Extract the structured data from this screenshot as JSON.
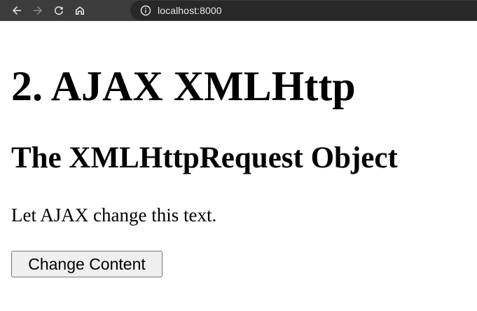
{
  "browser": {
    "url": "localhost:8000",
    "nav_icons": [
      "back-icon",
      "forward-icon",
      "reload-icon",
      "home-icon",
      "info-icon"
    ]
  },
  "page": {
    "heading": "2. AJAX XMLHttp",
    "subheading": "The XMLHttpRequest Object",
    "paragraph": "Let AJAX change this text.",
    "button_label": "Change Content"
  },
  "colors": {
    "toolbar_bg": "#3c3c3c",
    "omnibox_bg": "#282828",
    "icon": "#e8eaed",
    "page_bg": "#ffffff",
    "text": "#000000"
  }
}
